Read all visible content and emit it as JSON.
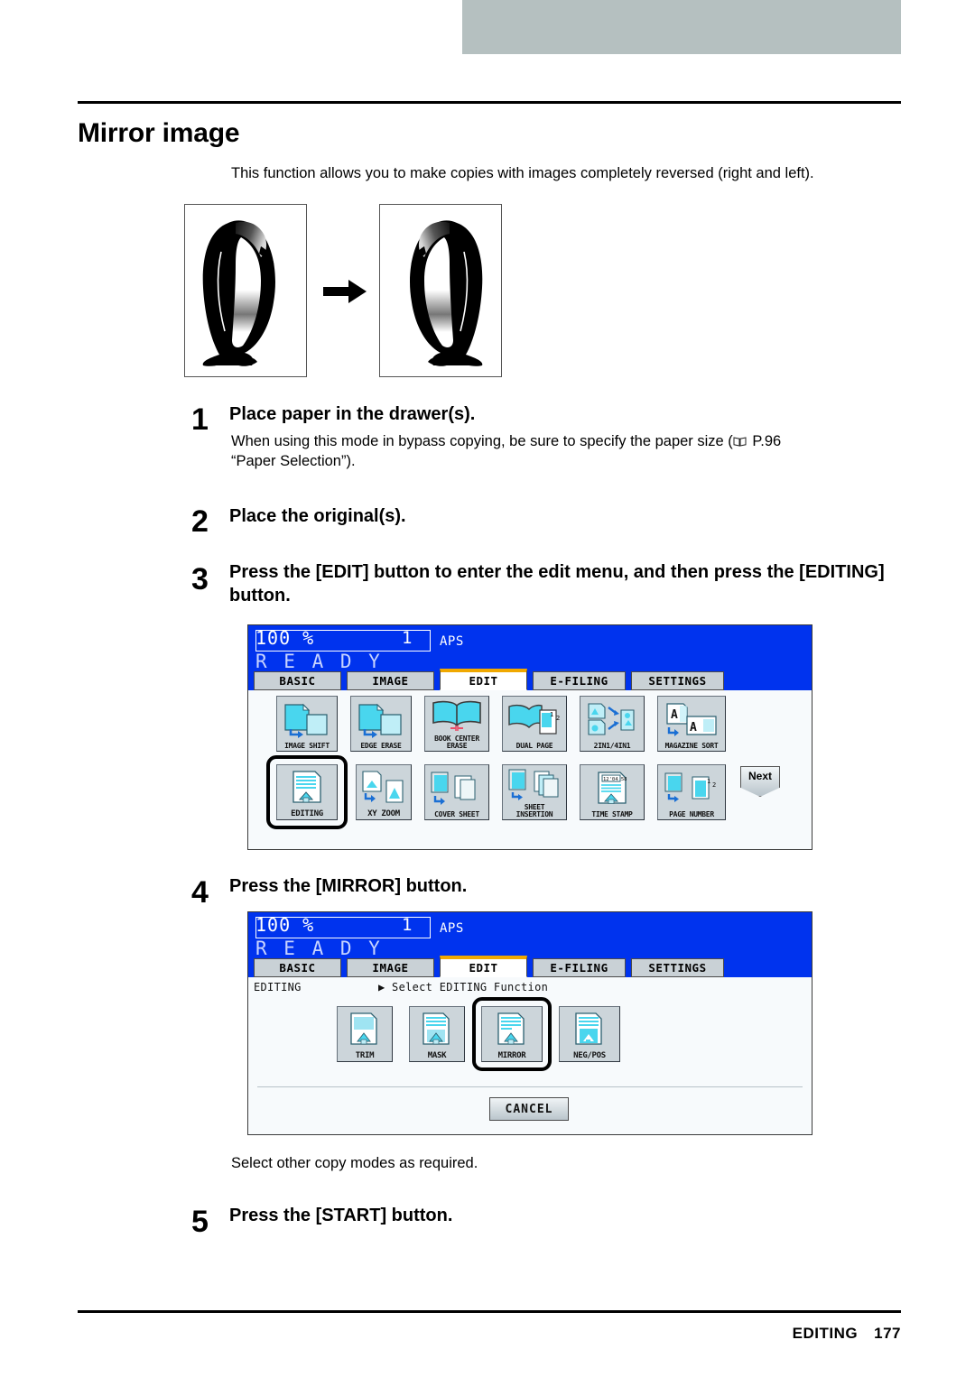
{
  "header": {
    "title": "Mirror image",
    "intro": "This function allows you to make copies with images completely reversed (right and left)."
  },
  "illustration": {
    "left_label": "original penguin image",
    "right_label": "mirrored penguin image",
    "arrow": "right-arrow"
  },
  "steps": [
    {
      "num": "1",
      "head": "Place paper in the drawer(s).",
      "body_pre": "When using this mode in bypass copying, be sure to specify the paper size (",
      "body_ref": " P.96",
      "body_post": "“Paper Selection”)."
    },
    {
      "num": "2",
      "head": "Place the original(s)."
    },
    {
      "num": "3",
      "head": "Press the [EDIT] button to enter the edit menu, and then press the [EDITING] button."
    },
    {
      "num": "4",
      "head": "Press the [MIRROR] button."
    },
    {
      "num": "5",
      "head": "Press the [START] button."
    }
  ],
  "note_after_step4": "Select other copy modes as required.",
  "lcd1": {
    "ratio": "100  %",
    "percent_unit": "%",
    "copies": "1",
    "paper_mode": "APS",
    "status": "R E A D Y",
    "tabs": [
      {
        "label": "BASIC",
        "active": false
      },
      {
        "label": "IMAGE",
        "active": false
      },
      {
        "label": "EDIT",
        "active": true
      },
      {
        "label": "E-FILING",
        "active": false
      },
      {
        "label": "SETTINGS",
        "active": false
      }
    ],
    "row1": [
      {
        "label": "IMAGE SHIFT",
        "icon": "image-shift-icon"
      },
      {
        "label": "EDGE ERASE",
        "icon": "edge-erase-icon"
      },
      {
        "label": "BOOK CENTER ERASE",
        "icon": "book-center-erase-icon"
      },
      {
        "label": "DUAL  PAGE",
        "icon": "dual-page-icon"
      },
      {
        "label": "2IN1/4IN1",
        "icon": "2in1-4in1-icon"
      },
      {
        "label": "MAGAZINE SORT",
        "icon": "magazine-sort-icon"
      }
    ],
    "row2": [
      {
        "label": "EDITING",
        "icon": "editing-icon",
        "selected": true
      },
      {
        "label": "XY ZOOM",
        "icon": "xy-zoom-icon",
        "selected": false
      },
      {
        "label": "COVER SHEET",
        "icon": "cover-sheet-icon",
        "selected": false
      },
      {
        "label": "SHEET INSERTION",
        "icon": "sheet-insertion-icon",
        "selected": false
      },
      {
        "label": "TIME STAMP",
        "icon": "time-stamp-icon",
        "selected": false
      },
      {
        "label": "PAGE NUMBER",
        "icon": "page-number-icon",
        "selected": false
      }
    ],
    "next_label": "Next"
  },
  "lcd2": {
    "ratio": "100  %",
    "copies": "1",
    "paper_mode": "APS",
    "status": "R E A D Y",
    "tabs": [
      {
        "label": "BASIC",
        "active": false
      },
      {
        "label": "IMAGE",
        "active": false
      },
      {
        "label": "EDIT",
        "active": true
      },
      {
        "label": "E-FILING",
        "active": false
      },
      {
        "label": "SETTINGS",
        "active": false
      }
    ],
    "breadcrumb_root": "EDITING",
    "breadcrumb_current": "▶ Select EDITING Function",
    "functions": [
      {
        "label": "TRIM",
        "icon": "trim-icon",
        "selected": false
      },
      {
        "label": "MASK",
        "icon": "mask-icon",
        "selected": false
      },
      {
        "label": "MIRROR",
        "icon": "mirror-icon",
        "selected": true
      },
      {
        "label": "NEG/POS",
        "icon": "neg-pos-icon",
        "selected": false
      }
    ],
    "cancel_label": "CANCEL"
  },
  "footer": {
    "section": "EDITING",
    "page": "177"
  },
  "colors": {
    "lcd_blue": "#0033ee",
    "tab_active_accent": "#f0a800",
    "top_bar": "#b5c0c0",
    "icon_cyan": "#49d6ee"
  }
}
